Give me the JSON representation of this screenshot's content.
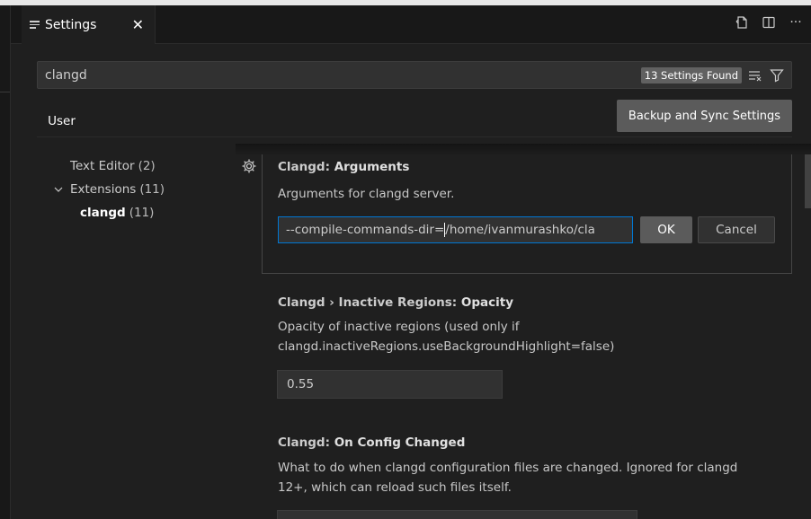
{
  "tab": {
    "title": "Settings",
    "close_icon": "close-icon"
  },
  "tab_actions": [
    "open-settings-json-icon",
    "split-editor-icon",
    "more-actions-icon"
  ],
  "search": {
    "value": "clangd",
    "result_badge": "13 Settings Found"
  },
  "scope": {
    "user_tab": "User",
    "sync_button": "Backup and Sync Settings"
  },
  "toc": {
    "text_editor": {
      "label": "Text Editor",
      "count": "(2)"
    },
    "extensions": {
      "label": "Extensions",
      "count": "(11)"
    },
    "clangd": {
      "label": "clangd",
      "count": "(11)"
    }
  },
  "settings": [
    {
      "category": "Clangd: ",
      "name": "Arguments",
      "description": "Arguments for clangd server.",
      "edit_value_before_cursor": "--compile-commands-dir=",
      "edit_value_after_cursor": "/home/ivanmurashko/cla",
      "ok_label": "OK",
      "cancel_label": "Cancel"
    },
    {
      "category": "Clangd › Inactive Regions: ",
      "name": "Opacity",
      "description_line1": "Opacity of inactive regions (used only if",
      "description_line2": "clangd.inactiveRegions.useBackgroundHighlight=false)",
      "value": "0.55"
    },
    {
      "category": "Clangd: ",
      "name": "On Config Changed",
      "description_line1": "What to do when clangd configuration files are changed. Ignored for clangd",
      "description_line2": "12+, which can reload such files itself."
    }
  ]
}
